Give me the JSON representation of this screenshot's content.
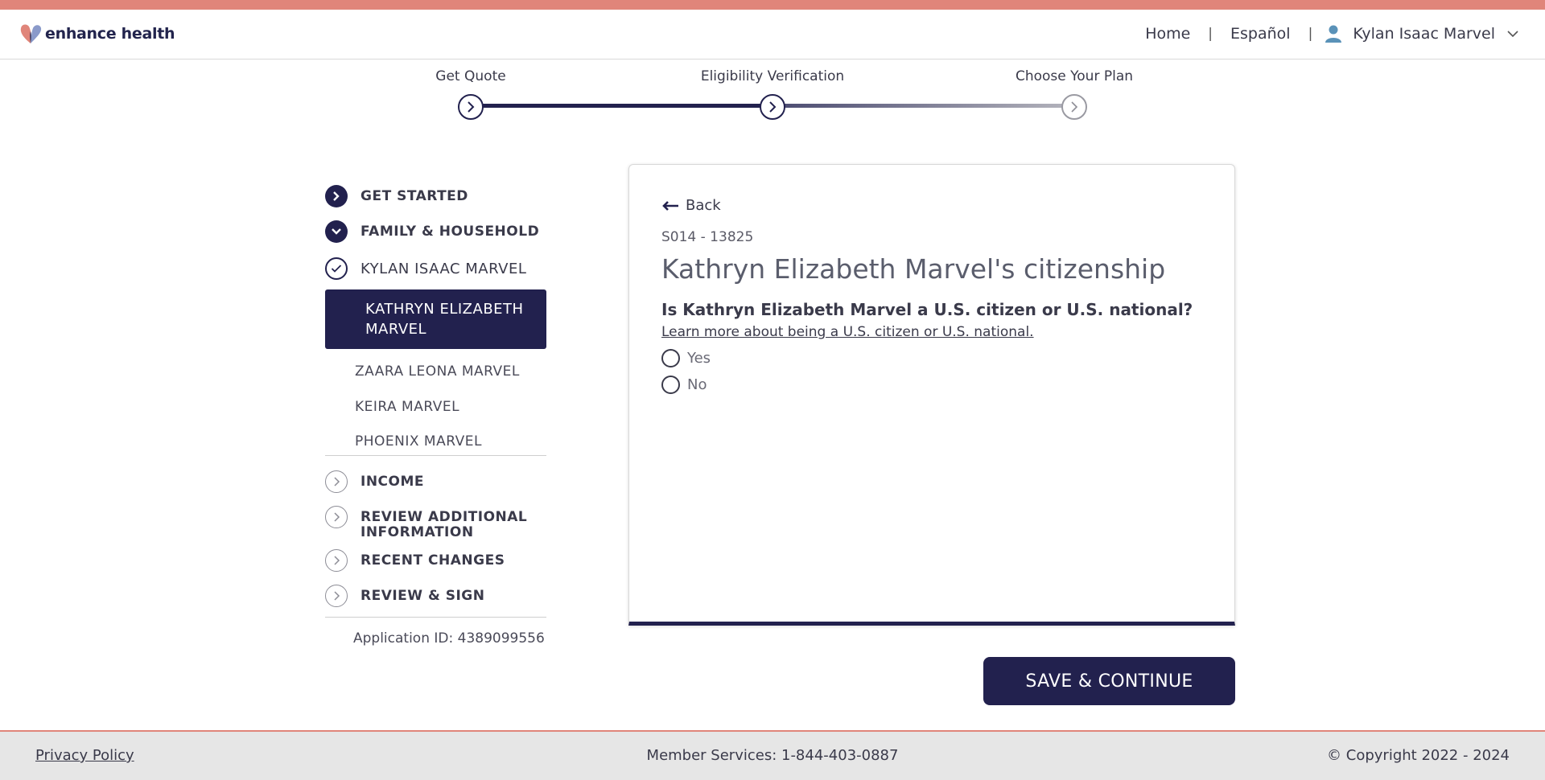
{
  "brand": {
    "name": "enhance health"
  },
  "nav": {
    "home": "Home",
    "separator": "|",
    "language": "Español",
    "user_name": "Kylan Isaac Marvel"
  },
  "stepper": {
    "steps": [
      {
        "label": "Get Quote",
        "state": "complete"
      },
      {
        "label": "Eligibility Verification",
        "state": "current"
      },
      {
        "label": "Choose Your Plan",
        "state": "upcoming"
      }
    ]
  },
  "sidebar": {
    "sections": [
      {
        "label": "GET STARTED",
        "state": "complete"
      },
      {
        "label": "FAMILY & HOUSEHOLD",
        "state": "expanded"
      }
    ],
    "members": [
      {
        "label": "KYLAN ISAAC MARVEL",
        "state": "done"
      },
      {
        "label": "KATHRYN ELIZABETH MARVEL",
        "state": "active"
      },
      {
        "label": "ZAARA LEONA MARVEL"
      },
      {
        "label": "KEIRA MARVEL"
      },
      {
        "label": "PHOENIX MARVEL"
      }
    ],
    "later_sections": [
      {
        "label": "INCOME"
      },
      {
        "label": "REVIEW ADDITIONAL INFORMATION"
      },
      {
        "label": "RECENT CHANGES"
      },
      {
        "label": "REVIEW & SIGN"
      }
    ],
    "application_id": "Application ID: 4389099556"
  },
  "card": {
    "back_label": "Back",
    "code": "S014 - 13825",
    "title": "Kathryn Elizabeth Marvel's citizenship",
    "question": "Is Kathryn Elizabeth Marvel a U.S. citizen or U.S. national?",
    "learn_more": "Learn more about being a U.S. citizen or U.S. national.",
    "options": [
      "Yes",
      "No"
    ]
  },
  "save_button": "SAVE & CONTINUE",
  "footer": {
    "privacy": "Privacy Policy",
    "member_services": "Member Services: 1-844-403-0887",
    "copyright": "© Copyright 2022 - 2024"
  },
  "colors": {
    "navy": "#22214e",
    "accent": "#e0857a",
    "gray_circle": "#8d8d96"
  }
}
